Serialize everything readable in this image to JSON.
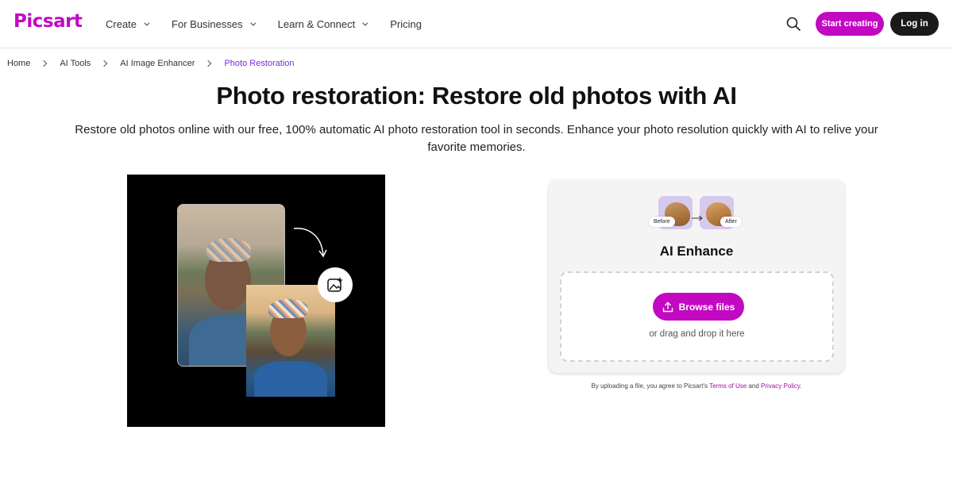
{
  "brand": {
    "logo": "Picsart",
    "accent": "#c209c1",
    "dark": "#1a1a1a"
  },
  "nav": {
    "items": [
      {
        "label": "Create",
        "has_dropdown": true
      },
      {
        "label": "For Businesses",
        "has_dropdown": true
      },
      {
        "label": "Learn & Connect",
        "has_dropdown": true
      },
      {
        "label": "Pricing",
        "has_dropdown": false
      }
    ],
    "start_label": "Start creating",
    "login_label": "Log in"
  },
  "breadcrumb": [
    "Home",
    "AI Tools",
    "AI Image Enhancer",
    "Photo Restoration"
  ],
  "hero": {
    "title": "Photo restoration: Restore old photos with AI",
    "subtitle": "Restore old photos online with our free, 100% automatic AI photo restoration tool in seconds. Enhance your photo resolution quickly with AI to relive your favorite memories."
  },
  "upload": {
    "before_tag": "Before",
    "after_tag": "After",
    "title": "AI Enhance",
    "browse_label": "Browse files",
    "drop_hint": "or drag and drop it here",
    "legal_prefix": "By uploading a file, you agree to Picsart's",
    "terms_label": "Terms of Use",
    "legal_and": "and",
    "privacy_label": "Privacy Policy."
  },
  "icons": [
    "search-icon",
    "chevron-down-icon",
    "chevron-right-icon",
    "upload-icon",
    "image-sparkle-icon",
    "curved-arrow-icon"
  ]
}
